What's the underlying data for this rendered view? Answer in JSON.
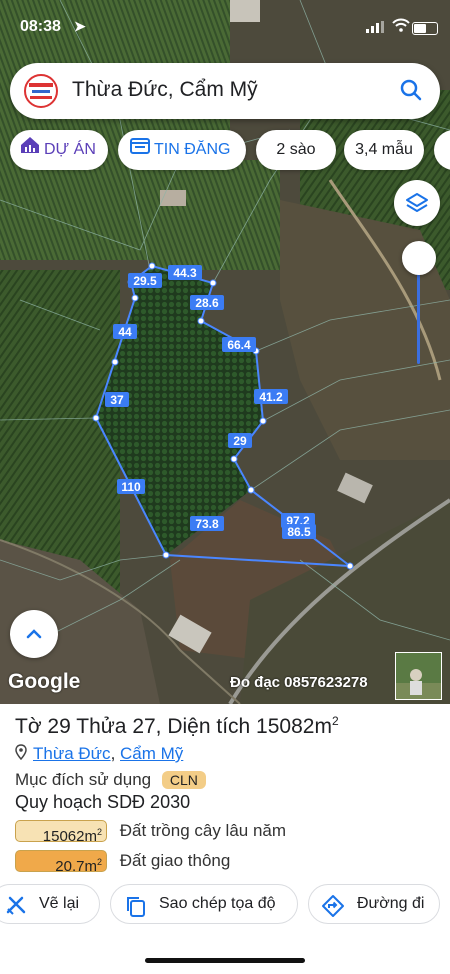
{
  "status": {
    "time": "08:38"
  },
  "search": {
    "title": "Thừa Đức, Cẩm Mỹ"
  },
  "chips": [
    {
      "label": "DỰ ÁN",
      "icon": "house-chart-icon"
    },
    {
      "label": "TIN ĐĂNG",
      "icon": "calendar-icon"
    },
    {
      "label": "2 sào"
    },
    {
      "label": "3,4 mẫu"
    }
  ],
  "map": {
    "attribution": "Google",
    "credit": "Đo đạc 0857623278",
    "edge_labels": [
      "29.5",
      "44.3",
      "28.6",
      "44",
      "66.4",
      "37",
      "41.2",
      "29",
      "110",
      "73.8",
      "86.5",
      "97.2"
    ]
  },
  "parcel": {
    "title_prefix": "Tờ 29 Thửa 27, Diện tích 15082m",
    "title_sup": "2",
    "location": [
      "Thừa Đức",
      "Cẩm Mỹ"
    ],
    "purpose_label": "Mục đích sử dụng",
    "purpose_code": "CLN",
    "plan_label": "Quy hoạch SDĐ 2030",
    "zones": [
      {
        "area": "15062m",
        "sup": "2",
        "label": "Đất trồng cây lâu năm",
        "color": "#f7e2b4"
      },
      {
        "area": "20.7m",
        "sup": "2",
        "label": "Đất giao thông",
        "color": "#f0a94a"
      }
    ]
  },
  "actions": [
    {
      "label": "Vẽ lại",
      "icon": "ruler-cross-icon"
    },
    {
      "label": "Sao chép tọa độ",
      "icon": "copy-icon"
    },
    {
      "label": "Đường đi",
      "icon": "directions-icon"
    }
  ],
  "colors": {
    "accent": "#1a73e8",
    "boundary": "#4a86ff",
    "label_bg": "#3b7cf4"
  }
}
